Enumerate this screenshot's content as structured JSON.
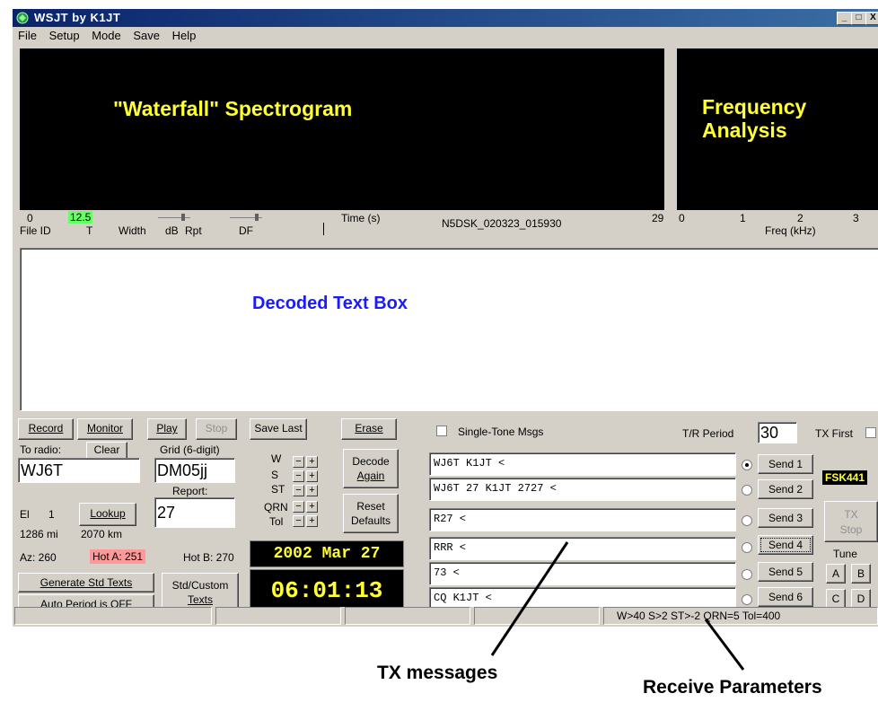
{
  "window": {
    "title": "WSJT   by K1JT",
    "controls": [
      "_",
      "□",
      "X"
    ]
  },
  "menu": [
    "File",
    "Setup",
    "Mode",
    "Save",
    "Help"
  ],
  "waterfall": {
    "caption": "\"Waterfall\" Spectrogram"
  },
  "freq_analysis": {
    "caption_line1": "Frequency",
    "caption_line2": "Analysis"
  },
  "axis_under_waterfall": {
    "zero": "0",
    "highlight": "12.5",
    "time_label": "Time (s)",
    "filename": "N5DSK_020323_015930",
    "end": "29",
    "file_id": "File ID",
    "t": "T",
    "width": "Width",
    "db": "dB",
    "rpt": "Rpt",
    "df": "DF",
    "highlight_color": "#66ff66"
  },
  "freq_axis": {
    "ticks": [
      "0",
      "1",
      "2",
      "3"
    ],
    "label": "Freq (kHz)"
  },
  "decoded": {
    "caption": "Decoded Text Box",
    "caption_color": "#1a1aff"
  },
  "buttons": {
    "record": "Record",
    "monitor": "Monitor",
    "play": "Play",
    "stop": "Stop",
    "save_last": "Save Last",
    "erase": "Erase",
    "clear": "Clear",
    "lookup": "Lookup",
    "decode_again_1": "Decode",
    "decode_again_2": "Again",
    "reset_defaults_1": "Reset",
    "reset_defaults_2": "Defaults",
    "generate_std": "Generate Std Texts",
    "auto_period": "Auto Period is OFF",
    "std_custom_1": "Std/Custom",
    "std_custom_2": "Texts",
    "tx_stop_1": "TX",
    "tx_stop_2": "Stop"
  },
  "station": {
    "to_radio_label": "To radio:",
    "to_radio_value": "WJ6T",
    "grid_label": "Grid (6-digit)",
    "grid_value": "DM05jj",
    "report_label": "Report:",
    "report_value": "27",
    "el_label": "El",
    "el_value": "1",
    "distance_mi": "1286 mi",
    "distance_km": "2070 km",
    "az": "Az: 260",
    "hot_a": "Hot A: 251",
    "hot_b": "Hot B: 270",
    "hot_a_color": "#ff9999"
  },
  "params": {
    "w": "W",
    "s": "S",
    "st": "ST",
    "qrn": "QRN",
    "tol": "Tol",
    "minus": "−",
    "plus": "+"
  },
  "clock": {
    "date": "2002 Mar 27",
    "time": "06:01:13",
    "color": "#ffff33"
  },
  "single_tone": {
    "label": "Single-Tone Msgs",
    "checked": false
  },
  "tr_period": {
    "label": "T/R Period",
    "value": "30"
  },
  "tx_first": {
    "label": "TX First",
    "checked": false
  },
  "tx_messages": [
    {
      "text": "WJ6T K1JT <",
      "send": "Send 1",
      "selected": true
    },
    {
      "text": "WJ6T 27 K1JT 2727 <",
      "send": "Send 2",
      "selected": false
    },
    {
      "text": "R27 <",
      "send": "Send 3",
      "selected": false
    },
    {
      "text": "RRR <",
      "send": "Send 4",
      "selected": false
    },
    {
      "text": "73 <",
      "send": "Send 5",
      "selected": false
    },
    {
      "text": "CQ K1JT <",
      "send": "Send 6",
      "selected": false
    }
  ],
  "mode_label": "FSK441",
  "mode_color": "#ffff33",
  "tune": {
    "label": "Tune",
    "buttons": [
      "A",
      "B",
      "C",
      "D"
    ]
  },
  "status_bar": {
    "params_text": "W>40  S>2  ST>-2 QRN=5  Tol=400"
  },
  "annotations": {
    "tx_messages": "TX messages",
    "receive_parameters": "Receive Parameters"
  }
}
